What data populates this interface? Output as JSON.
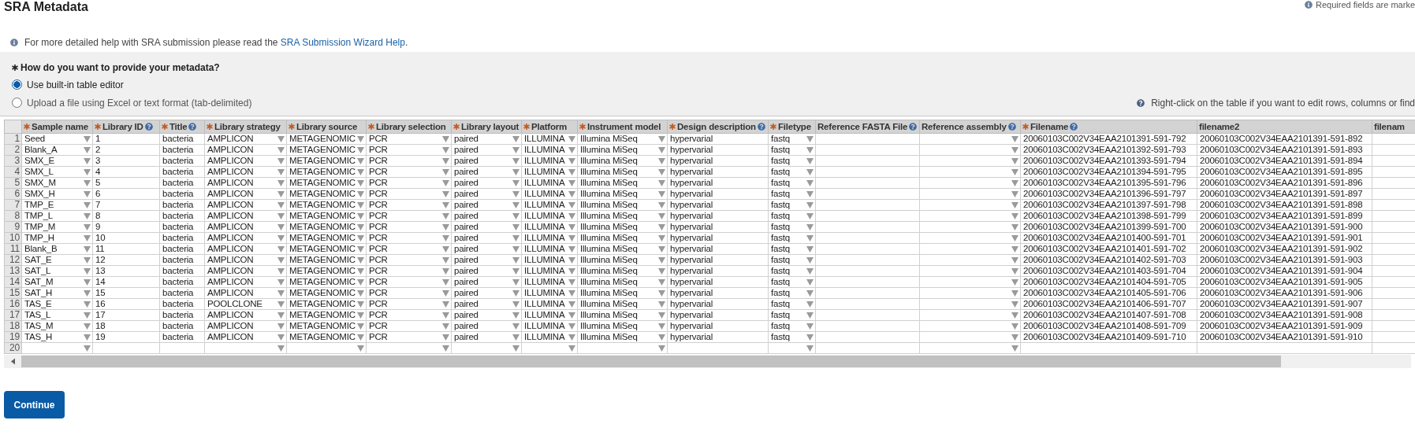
{
  "page": {
    "title": "SRA Metadata",
    "required_note": "Required fields are marke"
  },
  "help": {
    "text": "For more detailed help with SRA submission please read the ",
    "link": "SRA Submission Wizard Help",
    "end": "."
  },
  "metadata_choice": {
    "question": "How do you want to provide your metadata?",
    "required": true,
    "options": [
      {
        "label": "Use built-in table editor",
        "selected": true
      },
      {
        "label": "Upload a file using Excel or text format (tab-delimited)",
        "selected": false
      }
    ],
    "hint": "Right-click on the table if you want to edit rows, columns or find"
  },
  "table": {
    "columns": [
      {
        "label": "Sample name",
        "required": true,
        "help": false,
        "kind": "dropdown"
      },
      {
        "label": "Library ID",
        "required": true,
        "help": true,
        "kind": "text"
      },
      {
        "label": "Title",
        "required": true,
        "help": true,
        "kind": "text"
      },
      {
        "label": "Library strategy",
        "required": true,
        "help": false,
        "kind": "dropdown"
      },
      {
        "label": "Library source",
        "required": true,
        "help": false,
        "kind": "dropdown"
      },
      {
        "label": "Library selection",
        "required": true,
        "help": false,
        "kind": "dropdown"
      },
      {
        "label": "Library layout",
        "required": true,
        "help": false,
        "kind": "dropdown"
      },
      {
        "label": "Platform",
        "required": true,
        "help": false,
        "kind": "dropdown"
      },
      {
        "label": "Instrument model",
        "required": true,
        "help": false,
        "kind": "dropdown"
      },
      {
        "label": "Design description",
        "required": true,
        "help": true,
        "kind": "text"
      },
      {
        "label": "Filetype",
        "required": true,
        "help": false,
        "kind": "dropdown"
      },
      {
        "label": "Reference FASTA File",
        "required": false,
        "help": true,
        "kind": "text"
      },
      {
        "label": "Reference assembly",
        "required": false,
        "help": true,
        "kind": "dropdown"
      },
      {
        "label": "Filename",
        "required": true,
        "help": true,
        "kind": "text"
      },
      {
        "label": "filename2",
        "required": false,
        "help": false,
        "kind": "text"
      },
      {
        "label": "filenam",
        "required": false,
        "help": false,
        "kind": "text"
      }
    ],
    "rows": [
      {
        "number": "1",
        "cells": [
          "Seed",
          "1",
          "bacteria",
          "AMPLICON",
          "METAGENOMIC",
          "PCR",
          "paired",
          "ILLUMINA",
          "Illumina MiSeq",
          "hypervarial",
          "fastq",
          null,
          null,
          "20060103C002V34EAA2101391-591-792",
          "20060103C002V34EAA2101391-591-892"
        ]
      },
      {
        "number": "2",
        "cells": [
          "Blank_A",
          "2",
          "bacteria",
          "AMPLICON",
          "METAGENOMIC",
          "PCR",
          "paired",
          "ILLUMINA",
          "Illumina MiSeq",
          "hypervarial",
          "fastq",
          null,
          null,
          "20060103C002V34EAA2101392-591-793",
          "20060103C002V34EAA2101391-591-893"
        ]
      },
      {
        "number": "3",
        "cells": [
          "SMX_E",
          "3",
          "bacteria",
          "AMPLICON",
          "METAGENOMIC",
          "PCR",
          "paired",
          "ILLUMINA",
          "Illumina MiSeq",
          "hypervarial",
          "fastq",
          null,
          null,
          "20060103C002V34EAA2101393-591-794",
          "20060103C002V34EAA2101391-591-894"
        ]
      },
      {
        "number": "4",
        "cells": [
          "SMX_L",
          "4",
          "bacteria",
          "AMPLICON",
          "METAGENOMIC",
          "PCR",
          "paired",
          "ILLUMINA",
          "Illumina MiSeq",
          "hypervarial",
          "fastq",
          null,
          null,
          "20060103C002V34EAA2101394-591-795",
          "20060103C002V34EAA2101391-591-895"
        ]
      },
      {
        "number": "5",
        "cells": [
          "SMX_M",
          "5",
          "bacteria",
          "AMPLICON",
          "METAGENOMIC",
          "PCR",
          "paired",
          "ILLUMINA",
          "Illumina MiSeq",
          "hypervarial",
          "fastq",
          null,
          null,
          "20060103C002V34EAA2101395-591-796",
          "20060103C002V34EAA2101391-591-896"
        ]
      },
      {
        "number": "6",
        "cells": [
          "SMX_H",
          "6",
          "bacteria",
          "AMPLICON",
          "METAGENOMIC",
          "PCR",
          "paired",
          "ILLUMINA",
          "Illumina MiSeq",
          "hypervarial",
          "fastq",
          null,
          null,
          "20060103C002V34EAA2101396-591-797",
          "20060103C002V34EAA2101391-591-897"
        ]
      },
      {
        "number": "7",
        "cells": [
          "TMP_E",
          "7",
          "bacteria",
          "AMPLICON",
          "METAGENOMIC",
          "PCR",
          "paired",
          "ILLUMINA",
          "Illumina MiSeq",
          "hypervarial",
          "fastq",
          null,
          null,
          "20060103C002V34EAA2101397-591-798",
          "20060103C002V34EAA2101391-591-898"
        ]
      },
      {
        "number": "8",
        "cells": [
          "TMP_L",
          "8",
          "bacteria",
          "AMPLICON",
          "METAGENOMIC",
          "PCR",
          "paired",
          "ILLUMINA",
          "Illumina MiSeq",
          "hypervarial",
          "fastq",
          null,
          null,
          "20060103C002V34EAA2101398-591-799",
          "20060103C002V34EAA2101391-591-899"
        ]
      },
      {
        "number": "9",
        "cells": [
          "TMP_M",
          "9",
          "bacteria",
          "AMPLICON",
          "METAGENOMIC",
          "PCR",
          "paired",
          "ILLUMINA",
          "Illumina MiSeq",
          "hypervarial",
          "fastq",
          null,
          null,
          "20060103C002V34EAA2101399-591-700",
          "20060103C002V34EAA2101391-591-900"
        ]
      },
      {
        "number": "10",
        "cells": [
          "TMP_H",
          "10",
          "bacteria",
          "AMPLICON",
          "METAGENOMIC",
          "PCR",
          "paired",
          "ILLUMINA",
          "Illumina MiSeq",
          "hypervarial",
          "fastq",
          null,
          null,
          "20060103C002V34EAA2101400-591-701",
          "20060103C002V34EAA2101391-591-901"
        ]
      },
      {
        "number": "11",
        "cells": [
          "Blank_B",
          "11",
          "bacteria",
          "AMPLICON",
          "METAGENOMIC",
          "PCR",
          "paired",
          "ILLUMINA",
          "Illumina MiSeq",
          "hypervarial",
          "fastq",
          null,
          null,
          "20060103C002V34EAA2101401-591-702",
          "20060103C002V34EAA2101391-591-902"
        ]
      },
      {
        "number": "12",
        "cells": [
          "SAT_E",
          "12",
          "bacteria",
          "AMPLICON",
          "METAGENOMIC",
          "PCR",
          "paired",
          "ILLUMINA",
          "Illumina MiSeq",
          "hypervarial",
          "fastq",
          null,
          null,
          "20060103C002V34EAA2101402-591-703",
          "20060103C002V34EAA2101391-591-903"
        ]
      },
      {
        "number": "13",
        "cells": [
          "SAT_L",
          "13",
          "bacteria",
          "AMPLICON",
          "METAGENOMIC",
          "PCR",
          "paired",
          "ILLUMINA",
          "Illumina MiSeq",
          "hypervarial",
          "fastq",
          null,
          null,
          "20060103C002V34EAA2101403-591-704",
          "20060103C002V34EAA2101391-591-904"
        ]
      },
      {
        "number": "14",
        "cells": [
          "SAT_M",
          "14",
          "bacteria",
          "AMPLICON",
          "METAGENOMIC",
          "PCR",
          "paired",
          "ILLUMINA",
          "Illumina MiSeq",
          "hypervarial",
          "fastq",
          null,
          null,
          "20060103C002V34EAA2101404-591-705",
          "20060103C002V34EAA2101391-591-905"
        ]
      },
      {
        "number": "15",
        "cells": [
          "SAT_H",
          "15",
          "bacteria",
          "AMPLICON",
          "METAGENOMIC",
          "PCR",
          "paired",
          "ILLUMINA",
          "Illumina MiSeq",
          "hypervarial",
          "fastq",
          null,
          null,
          "20060103C002V34EAA2101405-591-706",
          "20060103C002V34EAA2101391-591-906"
        ]
      },
      {
        "number": "16",
        "cells": [
          "TAS_E",
          "16",
          "bacteria",
          "POOLCLONE",
          "METAGENOMIC",
          "PCR",
          "paired",
          "ILLUMINA",
          "Illumina MiSeq",
          "hypervarial",
          "fastq",
          null,
          null,
          "20060103C002V34EAA2101406-591-707",
          "20060103C002V34EAA2101391-591-907"
        ]
      },
      {
        "number": "17",
        "cells": [
          "TAS_L",
          "17",
          "bacteria",
          "AMPLICON",
          "METAGENOMIC",
          "PCR",
          "paired",
          "ILLUMINA",
          "Illumina MiSeq",
          "hypervarial",
          "fastq",
          null,
          null,
          "20060103C002V34EAA2101407-591-708",
          "20060103C002V34EAA2101391-591-908"
        ]
      },
      {
        "number": "18",
        "cells": [
          "TAS_M",
          "18",
          "bacteria",
          "AMPLICON",
          "METAGENOMIC",
          "PCR",
          "paired",
          "ILLUMINA",
          "Illumina MiSeq",
          "hypervarial",
          "fastq",
          null,
          null,
          "20060103C002V34EAA2101408-591-709",
          "20060103C002V34EAA2101391-591-909"
        ]
      },
      {
        "number": "19",
        "cells": [
          "TAS_H",
          "19",
          "bacteria",
          "AMPLICON",
          "METAGENOMIC",
          "PCR",
          "paired",
          "ILLUMINA",
          "Illumina MiSeq",
          "hypervarial",
          "fastq",
          null,
          null,
          "20060103C002V34EAA2101409-591-710",
          "20060103C002V34EAA2101391-591-910"
        ]
      },
      {
        "number": "20"
      }
    ]
  },
  "continue_button": "Continue"
}
